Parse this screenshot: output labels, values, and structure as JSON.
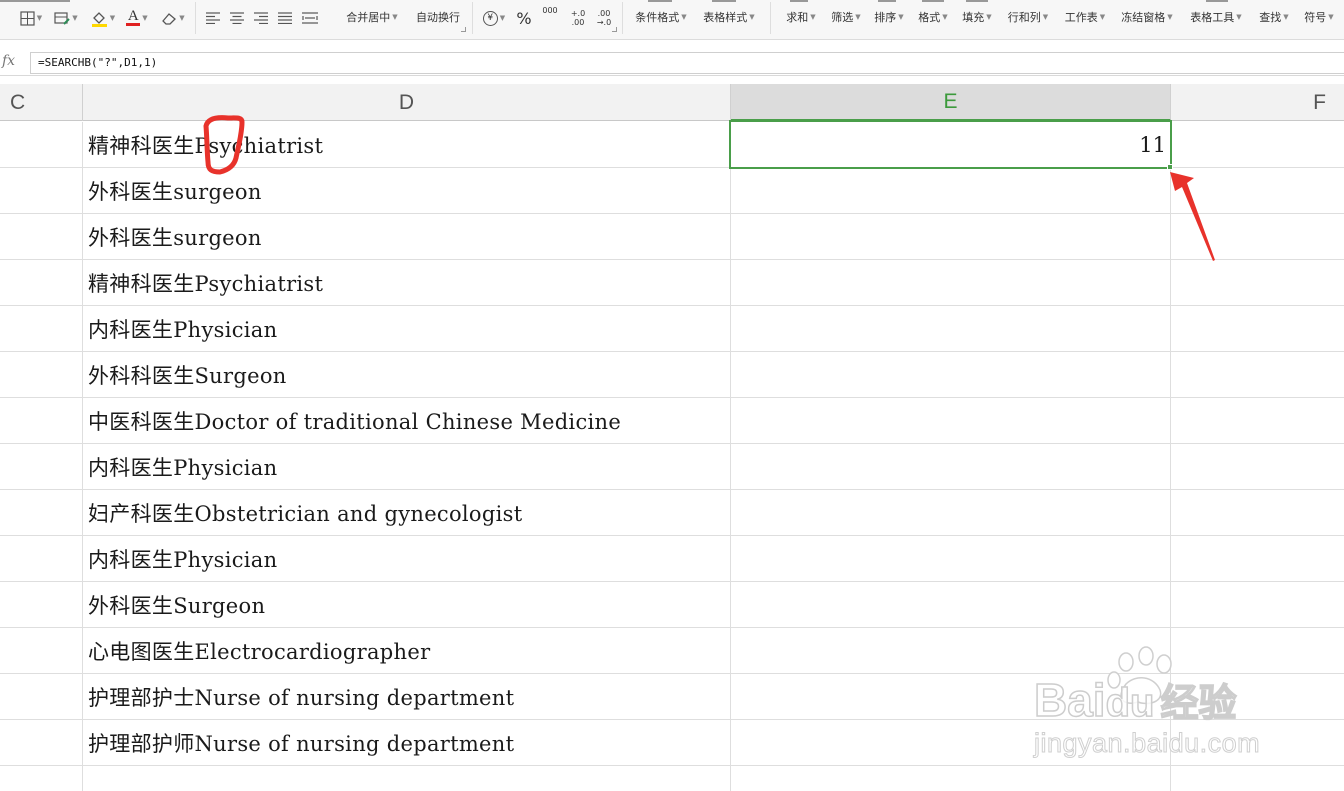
{
  "ribbon": {
    "merge_center": "合并居中",
    "wrap_text": "自动换行",
    "percent": "%",
    "thousands": "000",
    "decimal_inc": "+.0\n.00",
    "decimal_dec": ".00\n→.0",
    "conditional_format": "条件格式",
    "table_style": "表格样式",
    "sum": "求和",
    "filter": "筛选",
    "sort": "排序",
    "format": "格式",
    "fill": "填充",
    "rows_cols": "行和列",
    "worksheet": "工作表",
    "freeze_panes": "冻结窗格",
    "table_tools": "表格工具",
    "find": "查找",
    "symbol": "符号",
    "font_color": "A",
    "font_color_hex": "#e02020",
    "fill_color_hex": "#ffd800",
    "currency_symbol": "¥"
  },
  "formula_bar": {
    "fx_label": "fx",
    "formula": "=SEARCHB(\"?\",D1,1)"
  },
  "columns": {
    "c": "C",
    "d": "D",
    "e": "E",
    "f": "F"
  },
  "rows": [
    {
      "d": "精神科医生Psychiatrist",
      "e": "11"
    },
    {
      "d": "外科医生surgeon",
      "e": ""
    },
    {
      "d": "外科医生surgeon",
      "e": ""
    },
    {
      "d": "精神科医生Psychiatrist",
      "e": ""
    },
    {
      "d": "内科医生Physician",
      "e": ""
    },
    {
      "d": "外科科医生Surgeon",
      "e": ""
    },
    {
      "d": "中医科医生Doctor of traditional Chinese Medicine",
      "e": ""
    },
    {
      "d": "内科医生Physician",
      "e": ""
    },
    {
      "d": "妇产科医生Obstetrician and gynecologist",
      "e": ""
    },
    {
      "d": "内科医生Physician",
      "e": ""
    },
    {
      "d": "外科医生Surgeon",
      "e": ""
    },
    {
      "d": "心电图医生Electrocardiographer",
      "e": ""
    },
    {
      "d": "护理部护士Nurse of nursing department",
      "e": ""
    },
    {
      "d": "护理部护师Nurse of nursing department",
      "e": ""
    },
    {
      "d": "",
      "e": ""
    }
  ],
  "colors": {
    "selection": "#4a9e4a",
    "annotation": "#e8322b"
  },
  "watermark": {
    "brand": "Bai",
    "brand_du": "du",
    "brand_cn": "经验",
    "url": "jingyan.baidu.com"
  }
}
